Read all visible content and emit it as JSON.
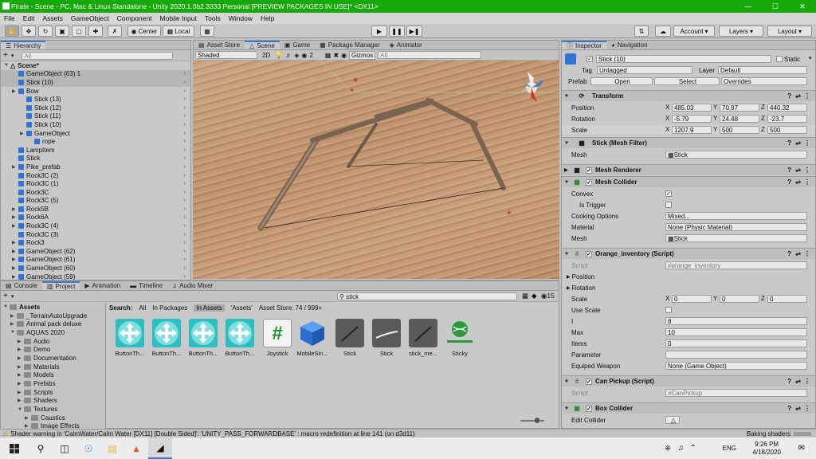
{
  "window": {
    "title": "Pirate - Scene - PC, Mac & Linux Standalone - Unity 2020.1.0b2.3333 Personal [PREVIEW PACKAGES IN USE]* <DX11>"
  },
  "menu": [
    "File",
    "Edit",
    "Assets",
    "GameObject",
    "Component",
    "Mobile Input",
    "Tools",
    "Window",
    "Help"
  ],
  "toolbar": {
    "center": "Center",
    "local": "Local",
    "account": "Account",
    "layers": "Layers",
    "layout": "Layout"
  },
  "hierarchy": {
    "tab": "Hierarchy",
    "search_placeholder": "All",
    "scene": "Scene*",
    "items": [
      {
        "label": "GameObject (63) 1",
        "depth": 1,
        "arrow": false,
        "sel": false,
        "hl": true
      },
      {
        "label": "Stick (10)",
        "depth": 1,
        "arrow": false,
        "sel": false,
        "hl": true
      },
      {
        "label": "Bow",
        "depth": 1,
        "arrow": true,
        "sel": false,
        "hl": false
      },
      {
        "label": "Stick (13)",
        "depth": 2,
        "arrow": false,
        "sel": false,
        "hl": false
      },
      {
        "label": "Stick (12)",
        "depth": 2,
        "arrow": false,
        "sel": false,
        "hl": false
      },
      {
        "label": "Stick (11)",
        "depth": 2,
        "arrow": false,
        "sel": false,
        "hl": false
      },
      {
        "label": "Stick (10)",
        "depth": 2,
        "arrow": false,
        "sel": false,
        "hl": false
      },
      {
        "label": "GameObject",
        "depth": 2,
        "arrow": true,
        "sel": false,
        "hl": false
      },
      {
        "label": "rope",
        "depth": 3,
        "arrow": false,
        "sel": false,
        "hl": false
      },
      {
        "label": "LampItem",
        "depth": 1,
        "arrow": false,
        "sel": false,
        "hl": false
      },
      {
        "label": "Stick",
        "depth": 1,
        "arrow": false,
        "sel": false,
        "hl": false
      },
      {
        "label": "Pike_prefab",
        "depth": 1,
        "arrow": true,
        "sel": false,
        "hl": false
      },
      {
        "label": "Rock3C (2)",
        "depth": 1,
        "arrow": false,
        "sel": false,
        "hl": false
      },
      {
        "label": "Rock3C (1)",
        "depth": 1,
        "arrow": false,
        "sel": false,
        "hl": false
      },
      {
        "label": "Rock3C",
        "depth": 1,
        "arrow": false,
        "sel": false,
        "hl": false
      },
      {
        "label": "Rock3C (5)",
        "depth": 1,
        "arrow": false,
        "sel": false,
        "hl": false
      },
      {
        "label": "Rock5B",
        "depth": 1,
        "arrow": true,
        "sel": false,
        "hl": false
      },
      {
        "label": "Rock6A",
        "depth": 1,
        "arrow": true,
        "sel": false,
        "hl": false
      },
      {
        "label": "Rock3C (4)",
        "depth": 1,
        "arrow": true,
        "sel": false,
        "hl": false
      },
      {
        "label": "Rock3C (3)",
        "depth": 1,
        "arrow": false,
        "sel": false,
        "hl": false
      },
      {
        "label": "Rock3",
        "depth": 1,
        "arrow": true,
        "sel": false,
        "hl": false
      },
      {
        "label": "GameObject (62)",
        "depth": 1,
        "arrow": true,
        "sel": false,
        "hl": false
      },
      {
        "label": "GameObject (61)",
        "depth": 1,
        "arrow": true,
        "sel": false,
        "hl": false
      },
      {
        "label": "GameObject (60)",
        "depth": 1,
        "arrow": true,
        "sel": false,
        "hl": false
      },
      {
        "label": "GameObject (59)",
        "depth": 1,
        "arrow": true,
        "sel": false,
        "hl": false
      }
    ]
  },
  "scene_tabs": [
    "Asset Store",
    "Scene",
    "Game",
    "Package Manager",
    "Animator"
  ],
  "scene_toolbar": {
    "shading": "Shaded",
    "mode2d": "2D",
    "gizmos": "Gizmos",
    "search_placeholder": "All",
    "layer_count": "2"
  },
  "bottom_tabs": [
    "Console",
    "Project",
    "Animation",
    "Timeline",
    "Audio Mixer"
  ],
  "project": {
    "search_value": "stick",
    "count": "15",
    "search_label": "Search:",
    "filters": [
      "All",
      "In Packages",
      "In Assets",
      "'Assets'",
      "Asset Store: 74 / 999+"
    ],
    "tree": [
      {
        "label": "Assets",
        "depth": 0
      },
      {
        "label": "_TerrainAutoUpgrade",
        "depth": 1
      },
      {
        "label": "Animal pack deluxe",
        "depth": 1
      },
      {
        "label": "AQUAS 2020",
        "depth": 1
      },
      {
        "label": "Audio",
        "depth": 2
      },
      {
        "label": "Demo",
        "depth": 2
      },
      {
        "label": "Documentation",
        "depth": 2
      },
      {
        "label": "Materials",
        "depth": 2
      },
      {
        "label": "Models",
        "depth": 2
      },
      {
        "label": "Prefabs",
        "depth": 2
      },
      {
        "label": "Scripts",
        "depth": 2
      },
      {
        "label": "Shaders",
        "depth": 2
      },
      {
        "label": "Textures",
        "depth": 2
      },
      {
        "label": "Caustics",
        "depth": 3
      },
      {
        "label": "Image Effects",
        "depth": 3
      }
    ],
    "assets": [
      {
        "label": "ButtonTh...",
        "kind": "move"
      },
      {
        "label": "ButtonTh...",
        "kind": "move"
      },
      {
        "label": "ButtonTh...",
        "kind": "move"
      },
      {
        "label": "ButtonTh...",
        "kind": "move"
      },
      {
        "label": "Joystick",
        "kind": "script"
      },
      {
        "label": "MobileSin...",
        "kind": "cube"
      },
      {
        "label": "Stick",
        "kind": "stick"
      },
      {
        "label": "Stick",
        "kind": "stickw"
      },
      {
        "label": "stick_me...",
        "kind": "stick"
      },
      {
        "label": "Sticky",
        "kind": "ball"
      }
    ]
  },
  "inspector": {
    "tabs": [
      "Inspector",
      "Navigation"
    ],
    "object_name": "Stick (10)",
    "static_label": "Static",
    "tag_label": "Tag",
    "tag_value": "Untagged",
    "layer_label": "Layer",
    "layer_value": "Default",
    "prefab_label": "Prefab",
    "prefab_open": "Open",
    "prefab_select": "Select",
    "prefab_overrides": "Overrides",
    "transform": {
      "title": "Transform",
      "position_label": "Position",
      "rotation_label": "Rotation",
      "scale_label": "Scale",
      "position": [
        "485.03",
        "70.97",
        "440.32"
      ],
      "rotation": [
        "-5.79",
        "24.48",
        "-23.7"
      ],
      "scale": [
        "1207.9",
        "500",
        "500"
      ]
    },
    "mesh_filter": {
      "title": "Stick (Mesh Filter)",
      "mesh_label": "Mesh",
      "mesh_value": "Stick"
    },
    "mesh_renderer": {
      "title": "Mesh Renderer"
    },
    "mesh_collider": {
      "title": "Mesh Collider",
      "convex_label": "Convex",
      "is_trigger_label": "Is Trigger",
      "cooking_label": "Cooking Options",
      "cooking_value": "Mixed...",
      "material_label": "Material",
      "material_value": "None (Physic Material)",
      "mesh_label": "Mesh",
      "mesh_value": "Stick"
    },
    "orange_inventory": {
      "title": "Orange_inventory (Script)",
      "script_label": "Script",
      "script_value": "orange_inventory",
      "position_label": "Position",
      "rotation_label": "Rotation",
      "scale_label": "Scale",
      "scale": [
        "0",
        "0",
        "0"
      ],
      "use_scale_label": "Use Scale",
      "i_label": "I",
      "i_value": "8",
      "max_label": "Max",
      "max_value": "10",
      "items_label": "Items",
      "items_value": "0",
      "parameter_label": "Parameter",
      "equiped_label": "Equiped Weapon",
      "equiped_value": "None (Game Object)"
    },
    "can_pickup": {
      "title": "Can Pickup (Script)",
      "script_label": "Script",
      "script_value": "CanPickup"
    },
    "box_collider": {
      "title": "Box Collider",
      "edit_label": "Edit Collider"
    }
  },
  "status": {
    "message": "Shader warning in 'CalmWater/Calm Water [DX11] [Double Sided]': 'UNITY_PASS_FORWARDBASE' : macro redefinition at line 141 (on d3d11)",
    "right": "Baking shaders"
  },
  "taskbar": {
    "lang": "ENG",
    "time": "9:26 PM",
    "date": "4/18/2020"
  },
  "colors": {
    "title_green": "#17a80a",
    "selection": "#8fb5e6",
    "accent": "#3a79d8"
  }
}
